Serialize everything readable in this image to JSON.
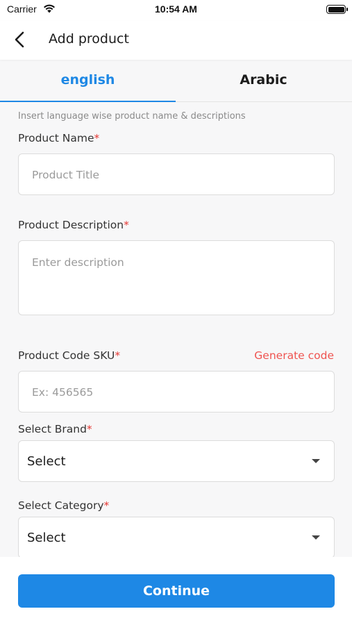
{
  "status_bar": {
    "carrier": "Carrier",
    "time": "10:54 AM"
  },
  "header": {
    "title": "Add product"
  },
  "tabs": [
    {
      "label": "english",
      "active": true
    },
    {
      "label": "Arabic",
      "active": false
    }
  ],
  "hint": "Insert language wise product name & descriptions",
  "form": {
    "required_mark": "*",
    "product_name": {
      "label": "Product Name",
      "placeholder": "Product Title"
    },
    "product_description": {
      "label": "Product Description",
      "placeholder": "Enter description"
    },
    "sku": {
      "label": "Product Code SKU",
      "placeholder": "Ex: 456565",
      "generate_label": "Generate code"
    },
    "brand": {
      "label": "Select Brand",
      "value": "Select"
    },
    "category": {
      "label": "Select Category",
      "value": "Select"
    }
  },
  "footer": {
    "continue_label": "Continue"
  },
  "colors": {
    "accent": "#1e88e5",
    "required": "#e53935",
    "generate": "#ef5350"
  }
}
